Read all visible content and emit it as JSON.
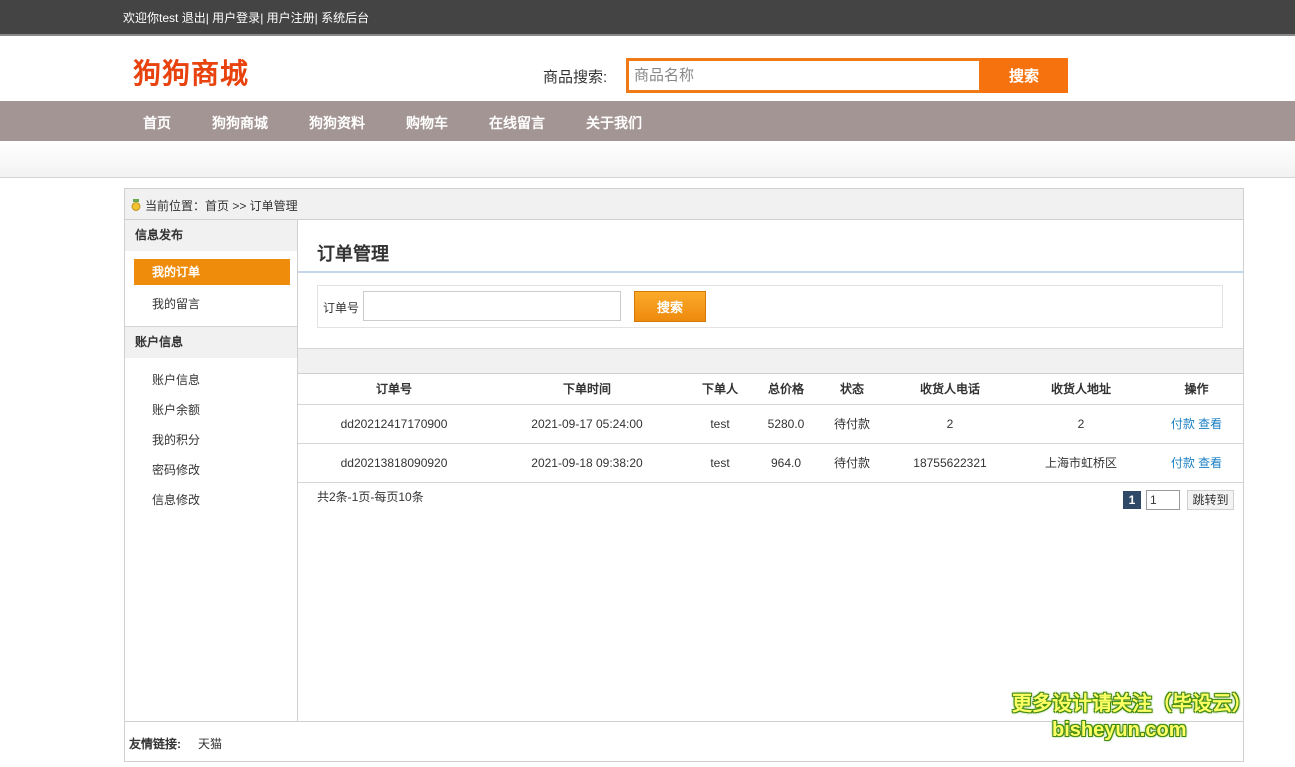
{
  "topbar": {
    "welcome": "欢迎你test",
    "logout": "退出",
    "sep1": "|",
    "login": "用户登录",
    "sep2": "|",
    "register": "用户注册",
    "sep3": "|",
    "admin": "系统后台"
  },
  "header": {
    "logo": "狗狗商城",
    "search_label": "商品搜索:",
    "search_placeholder": "商品名称",
    "search_button": "搜索"
  },
  "nav": [
    "首页",
    "狗狗商城",
    "狗狗资料",
    "购物车",
    "在线留言",
    "关于我们"
  ],
  "breadcrumb": "当前位置：首页 >> 订单管理",
  "sidebar": {
    "section1": "信息发布",
    "section1_items": [
      "我的订单",
      "我的留言"
    ],
    "section2": "账户信息",
    "section2_items": [
      "账户信息",
      "账户余额",
      "我的积分",
      "密码修改",
      "信息修改"
    ]
  },
  "content": {
    "title": "订单管理",
    "filter_label": "订单号",
    "filter_value": "",
    "filter_button": "搜索"
  },
  "table": {
    "headers": [
      "订单号",
      "下单时间",
      "下单人",
      "总价格",
      "状态",
      "收货人电话",
      "收货人地址",
      "操作"
    ],
    "rows": [
      [
        "dd20212417170900",
        "2021-09-17 05:24:00",
        "test",
        "5280.0",
        "待付款",
        "2",
        "2"
      ],
      [
        "dd20213818090920",
        "2021-09-18 09:38:20",
        "test",
        "964.0",
        "待付款",
        "18755622321",
        "上海市虹桥区"
      ]
    ],
    "action_pay": "付款",
    "action_view": "查看"
  },
  "pagination": {
    "info": "共2条-1页-每页10条",
    "current": "1",
    "input_value": "1",
    "go": "跳转到"
  },
  "footer": {
    "label": "友情链接:",
    "link": "天猫"
  },
  "watermark": {
    "line1": "更多设计请关注（毕设云）",
    "line2": "bisheyun.com"
  },
  "colors": {
    "brand_orange": "#f5720f",
    "nav_bg": "#a39593",
    "active_item": "#f08c0c",
    "link_blue": "#1a7fc1"
  }
}
